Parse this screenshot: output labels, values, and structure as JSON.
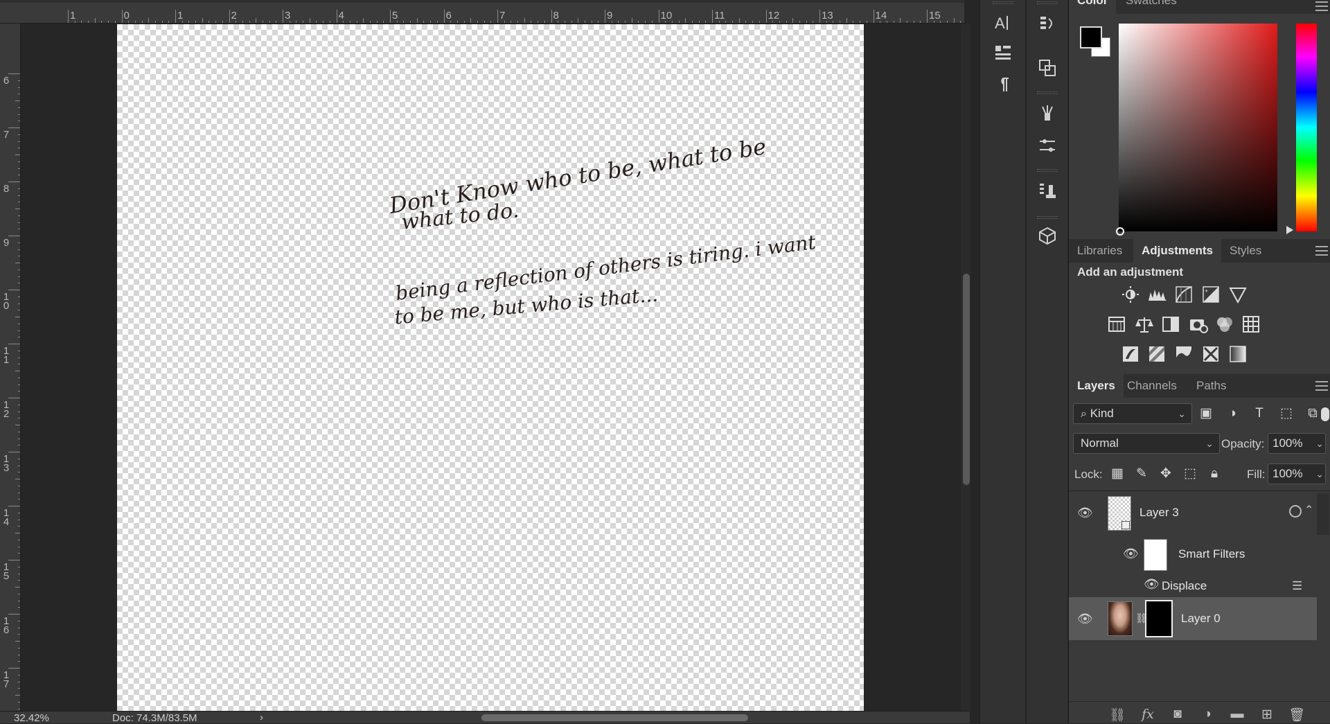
{
  "rulers": {
    "horizontal": [
      "1",
      "0",
      "1",
      "2",
      "3",
      "4",
      "5",
      "6",
      "7",
      "8",
      "9",
      "10",
      "11",
      "12",
      "13",
      "14",
      "15"
    ],
    "vertical": [
      "6",
      "7",
      "8",
      "9",
      "10",
      "11",
      "12",
      "13",
      "14",
      "15",
      "16",
      "17"
    ]
  },
  "canvas": {
    "handwriting": [
      "Don't Know who to be, what to be",
      "what to do.",
      "being a reflection of others is tiring. i want",
      "to be me, but who is that..."
    ]
  },
  "status": {
    "zoom": "32.42%",
    "doc_info": "Doc: 74.3M/83.5M",
    "arrow": "›"
  },
  "color_panel": {
    "tabs": [
      "Color",
      "Swatches"
    ],
    "active_tab": "Color",
    "foreground": "#000000",
    "background": "#ffffff",
    "hue_color": "#e11b1b"
  },
  "adjustments_panel": {
    "tabs": [
      "Libraries",
      "Adjustments",
      "Styles"
    ],
    "active_tab": "Adjustments",
    "heading": "Add an adjustment",
    "icons_row1": [
      "brightness-contrast-icon",
      "levels-icon",
      "curves-icon",
      "exposure-icon",
      "vibrance-icon"
    ],
    "icons_row2": [
      "hue-saturation-icon",
      "color-balance-icon",
      "black-white-icon",
      "photo-filter-icon",
      "channel-mixer-icon",
      "color-lookup-icon"
    ],
    "icons_row3": [
      "invert-icon",
      "posterize-icon",
      "threshold-icon",
      "selective-color-icon",
      "gradient-map-icon"
    ]
  },
  "layers_panel": {
    "tabs": [
      "Layers",
      "Channels",
      "Paths"
    ],
    "active_tab": "Layers",
    "filter_kind": "Kind",
    "blend_mode": "Normal",
    "opacity_label": "Opacity:",
    "opacity": "100%",
    "lock_label": "Lock:",
    "fill_label": "Fill:",
    "fill": "100%",
    "layers": [
      {
        "name": "Layer 3",
        "type": "smart-object"
      },
      {
        "name": "Smart Filters",
        "type": "smart-filters"
      },
      {
        "name": "Displace",
        "type": "filter"
      },
      {
        "name": "Layer 0",
        "type": "masked",
        "selected": true
      }
    ]
  }
}
